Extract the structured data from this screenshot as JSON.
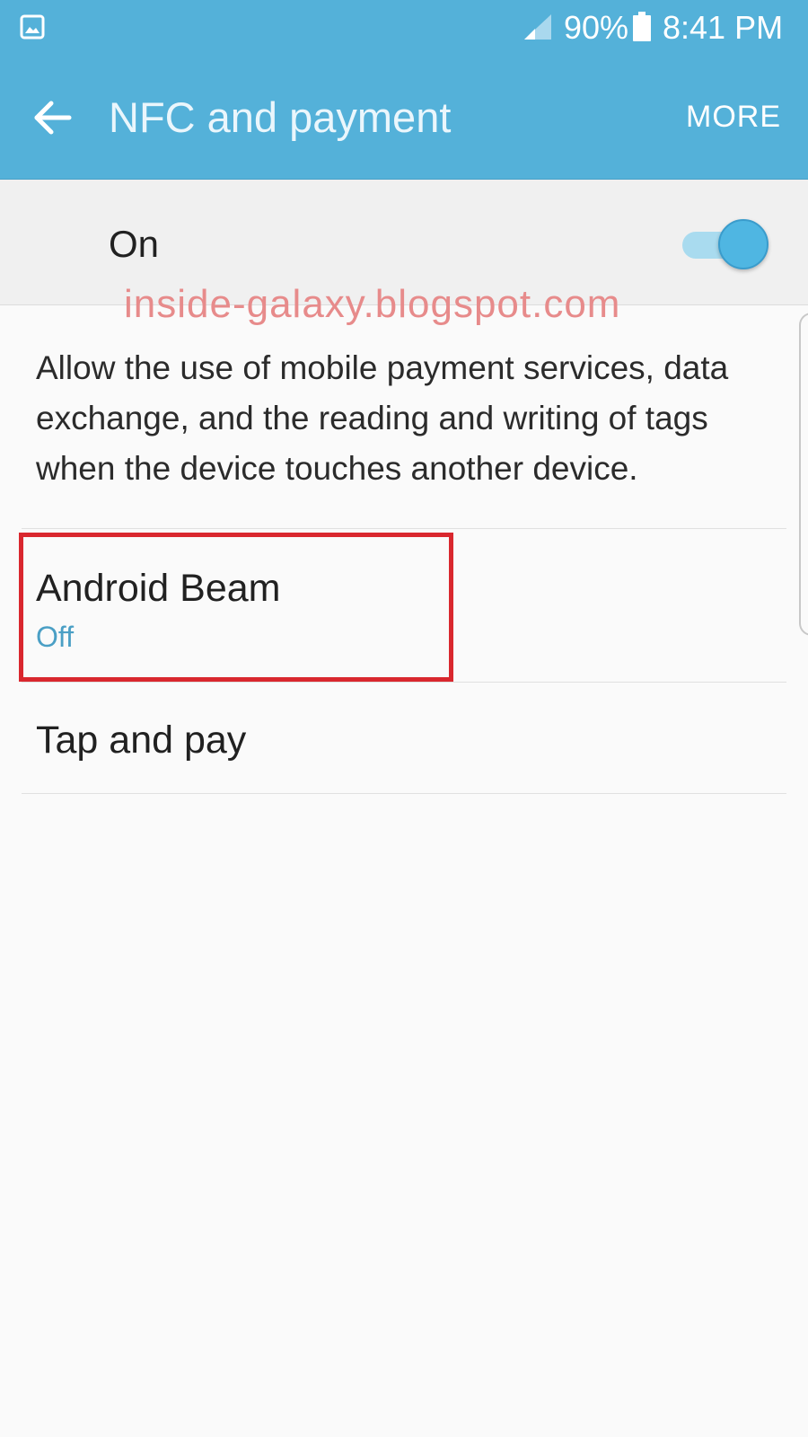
{
  "status_bar": {
    "battery_percent": "90%",
    "time": "8:41 PM",
    "icons": [
      "gallery-icon",
      "signal-icon",
      "battery-icon"
    ]
  },
  "app_bar": {
    "title": "NFC and payment",
    "more_label": "MORE",
    "back_icon": "arrow-left-icon"
  },
  "master_switch": {
    "label": "On",
    "state": "on"
  },
  "watermark": "inside-galaxy.blogspot.com",
  "description": "Allow the use of mobile payment services, data exchange, and the reading and writing of tags when the device touches another device.",
  "items": [
    {
      "title": "Android Beam",
      "subtitle": "Off"
    },
    {
      "title": "Tap and pay"
    }
  ],
  "colors": {
    "header": "#54b1d9",
    "accent": "#4fb6e2",
    "subtitle": "#4a9fc5",
    "highlight": "#d9272e",
    "watermark": "#e78b8b"
  }
}
